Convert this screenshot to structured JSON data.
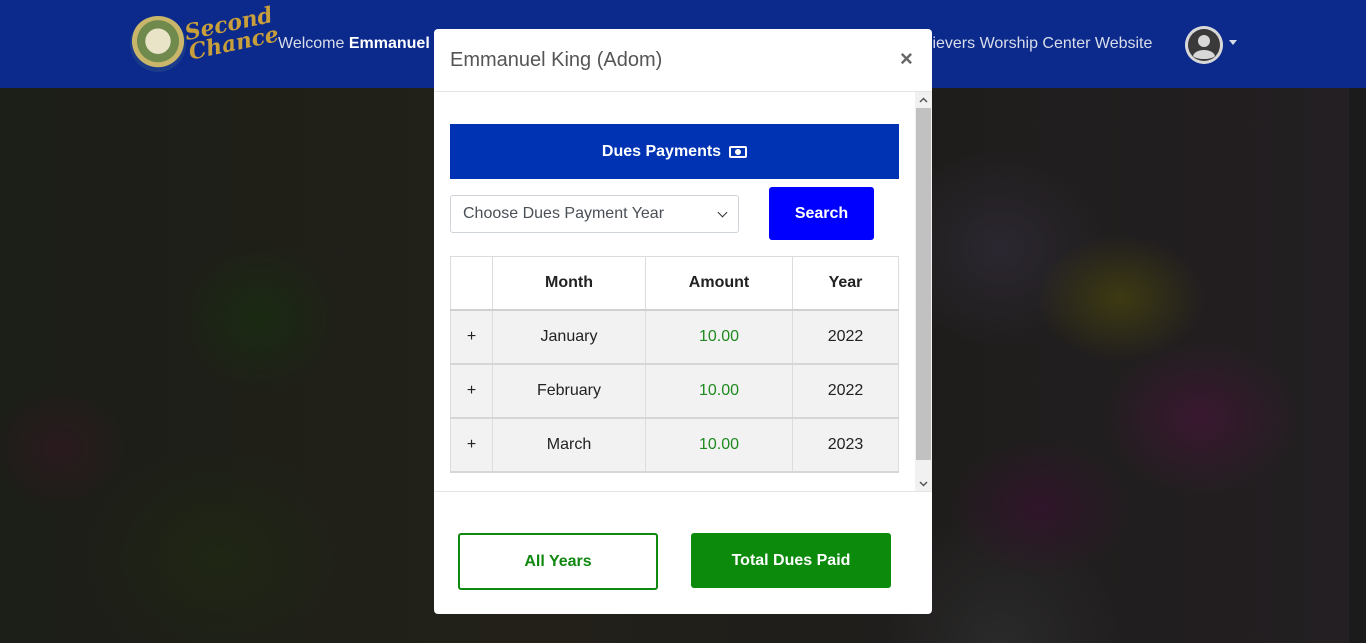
{
  "navbar": {
    "logo_text_line1": "Second",
    "logo_text_line2": "Chance",
    "welcome_prefix": "Welcome",
    "welcome_name": "Emmanuel",
    "site_link": "elievers Worship Center Website"
  },
  "modal": {
    "title": "Emmanuel King (Adom)",
    "close_label": "×",
    "dues_button": "Dues Payments",
    "year_select_placeholder": "Choose Dues Payment Year",
    "search_button": "Search",
    "table": {
      "headers": [
        "",
        "Month",
        "Amount",
        "Year"
      ],
      "rows": [
        {
          "expand": "+",
          "month": "January",
          "amount": "10.00",
          "year": "2022"
        },
        {
          "expand": "+",
          "month": "February",
          "amount": "10.00",
          "year": "2022"
        },
        {
          "expand": "+",
          "month": "March",
          "amount": "10.00",
          "year": "2023"
        }
      ]
    },
    "all_years_button": "All Years",
    "total_button": "Total Dues Paid"
  },
  "colors": {
    "navbar": "#0b2a8c",
    "dues_button": "#0033b3",
    "search_button": "#0000ff",
    "amount_text": "#1e8a1e",
    "total_button": "#0c8a0c"
  },
  "icons": {
    "dues_button_icon": "money-bill-icon",
    "user_menu": "user-circle-icon"
  }
}
